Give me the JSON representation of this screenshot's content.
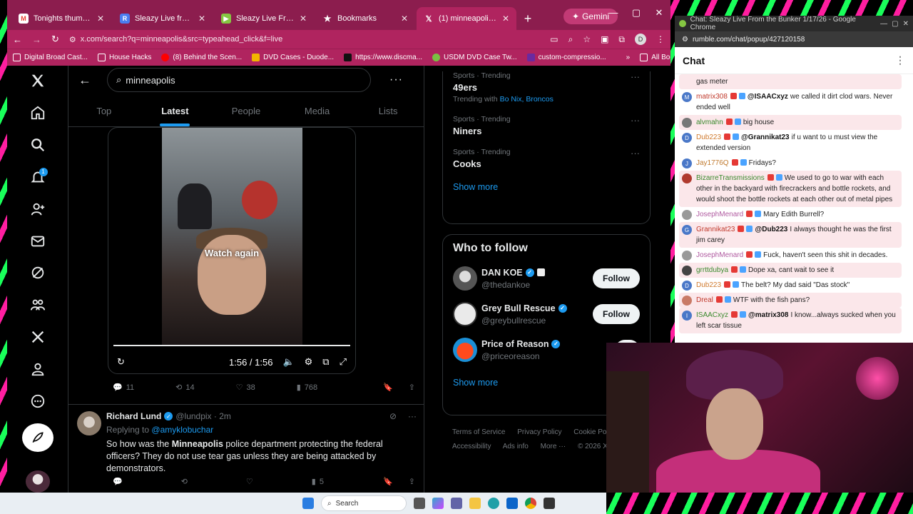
{
  "browser": {
    "tabs": [
      {
        "title": "Tonights thumbs - hyperec",
        "favicon": "gmail-icon",
        "color": "#ea4335"
      },
      {
        "title": "Sleazy Live from the Bunk",
        "favicon": "rumble-icon",
        "color": "#4a7df0"
      },
      {
        "title": "Sleazy Live From the Bunk",
        "favicon": "rumble-play-icon",
        "color": "#85c742"
      },
      {
        "title": "Bookmarks",
        "favicon": "star-icon",
        "color": "#ffffff"
      },
      {
        "title": "(1) minneapolis - Search /",
        "favicon": "x-icon",
        "color": "#000000"
      }
    ],
    "gemini_label": "Gemini",
    "url": "x.com/search?q=minneapolis&src=typeahead_click&f=live",
    "bookmarks": [
      {
        "label": "Digital Broad Cast..."
      },
      {
        "label": "House Hacks"
      },
      {
        "label": "(8) Behind the Scen..."
      },
      {
        "label": "DVD Cases - Duode..."
      },
      {
        "label": "https://www.discma..."
      },
      {
        "label": "USDM DVD Case Tw..."
      },
      {
        "label": "custom-compressio..."
      }
    ],
    "all_bookmarks": "All Bookmarks",
    "more_bookmarks": "»"
  },
  "x": {
    "search_query": "minneapolis",
    "notifications_count": "1",
    "tabs": [
      "Top",
      "Latest",
      "People",
      "Media",
      "Lists"
    ],
    "active_tab": "Latest",
    "video": {
      "watch_again": "Watch again",
      "time": "1:56 / 1:56"
    },
    "tweet1_actions": {
      "replies": "11",
      "reposts": "14",
      "likes": "38",
      "views": "768"
    },
    "tweet2": {
      "name": "Richard Lund",
      "handle": "@lundpix · 2m",
      "replying_label": "Replying to",
      "replying_to": "@amyklobuchar",
      "text_before": "So how was the ",
      "text_bold": "Minneapolis",
      "text_after": " police department protecting the federal officers? They do not use tear gas unless they are being attacked by demonstrators.",
      "views": "5"
    },
    "trends": [
      {
        "category": "Sports · Trending",
        "name": "49ers",
        "with_label": "Trending with",
        "with": "Bo Nix, Broncos"
      },
      {
        "category": "Sports · Trending",
        "name": "Niners"
      },
      {
        "category": "Sports · Trending",
        "name": "Cooks"
      }
    ],
    "show_more": "Show more",
    "who_to_follow": "Who to follow",
    "follow_suggestions": [
      {
        "name": "DAN KOE",
        "handle": "@thedankoe",
        "button": "Follow"
      },
      {
        "name": "Grey Bull Rescue",
        "handle": "@greybullrescue",
        "button": "Follow"
      },
      {
        "name": "Price of Reason",
        "handle": "@priceoreason",
        "button": "F"
      }
    ],
    "show_more_2": "Show more",
    "footer": [
      "Terms of Service",
      "Privacy Policy",
      "Cookie Polic",
      "Accessibility",
      "Ads info",
      "More ···",
      "© 2026 X C"
    ]
  },
  "chat_window": {
    "title": "Chat: Sleazy Live From the Bunker 1/17/26 - Google Chrome",
    "url": "rumble.com/chat/popup/427120158",
    "heading": "Chat",
    "messages": [
      {
        "user": "",
        "color": "#222",
        "text": "gas meter",
        "highlight": true,
        "avatar": ""
      },
      {
        "user": "matrix308",
        "color": "#c0392b",
        "mention": "@ISAACxyz",
        "text": "we called it dirt clod wars. Never ended well",
        "highlight": false,
        "avatar": "M",
        "avcolor": "#4a78c8"
      },
      {
        "user": "alvmahn",
        "color": "#3b8a2e",
        "text": "big house",
        "highlight": true,
        "avatar": "",
        "avcolor": "#777"
      },
      {
        "user": "Dub223",
        "color": "#d07a2e",
        "mention": "@Grannikat23",
        "text": "if u want to u must view the extended version",
        "highlight": false,
        "avatar": "D",
        "avcolor": "#4a78c8"
      },
      {
        "user": "Jay1776Q",
        "color": "#c07a2e",
        "text": "Fridays?",
        "highlight": false,
        "avatar": "J",
        "avcolor": "#4a78c8"
      },
      {
        "user": "BizarreTransmissions",
        "color": "#3b8a2e",
        "text": "We used to go to war with each other in the backyard with firecrackers and bottle rockets, and would shoot the bottle rockets at each other out of metal pipes",
        "highlight": true,
        "avatar": "",
        "avcolor": "#b03a2e"
      },
      {
        "user": "JosephMenard",
        "color": "#b05aa0",
        "text": "Mary Edith Burrell?",
        "highlight": false,
        "avatar": "",
        "avcolor": "#999"
      },
      {
        "user": "Grannikat23",
        "color": "#c0392b",
        "mention": "@Dub223",
        "text": "I always thought he was the first jim carey",
        "highlight": true,
        "avatar": "G",
        "avcolor": "#4a78c8"
      },
      {
        "user": "JosephMenard",
        "color": "#b05aa0",
        "text": "Fuck, haven't seen this shit in decades.",
        "highlight": false,
        "avatar": "",
        "avcolor": "#999"
      },
      {
        "user": "grrttdubya",
        "color": "#3b8a2e",
        "text": "Dope xa, cant wait to see it",
        "highlight": true,
        "avatar": "",
        "avcolor": "#444"
      },
      {
        "user": "Dub223",
        "color": "#d07a2e",
        "text": "The belt? My dad said \"Das stock\"",
        "highlight": false,
        "avatar": "D",
        "avcolor": "#4a78c8"
      },
      {
        "user": "Dreal",
        "color": "#c0392b",
        "text": "WTF with the fish pans?",
        "highlight": true,
        "avatar": "",
        "avcolor": "#c97a66"
      },
      {
        "user": "ISAACxyz",
        "color": "#3b8a2e",
        "mention": "@matrix308",
        "text": "I know...always sucked when you left scar tissue",
        "highlight": true,
        "avatar": "I",
        "avcolor": "#4a78c8"
      }
    ]
  },
  "taskbar": {
    "search": "Search"
  }
}
